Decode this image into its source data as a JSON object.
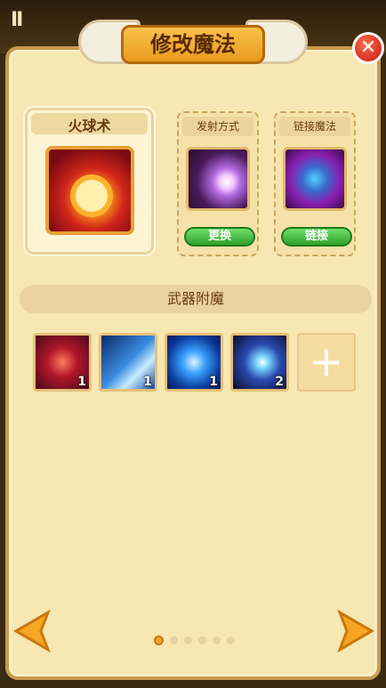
{
  "window": {
    "title": "修改魔法"
  },
  "hud": {
    "pause_icon": "pause-icon"
  },
  "main_spell": {
    "name": "火球术",
    "icon": "fireball-spell-icon"
  },
  "slots": [
    {
      "title": "发射方式",
      "icon": "purple-shot-icon",
      "button": "更换"
    },
    {
      "title": "链接魔法",
      "icon": "chain-link-icon",
      "button": "链接"
    }
  ],
  "enchant": {
    "title": "武器附魔",
    "items": [
      {
        "icon": "red-vortex-icon",
        "count": "1"
      },
      {
        "icon": "ice-slash-icon",
        "count": "1"
      },
      {
        "icon": "blue-disc-icon",
        "count": "1"
      },
      {
        "icon": "lightning-burst-icon",
        "count": "2"
      }
    ],
    "add_label": "+"
  },
  "pager": {
    "pages": 6,
    "active": 0
  },
  "colors": {
    "accent": "#f6a623",
    "close": "#d3261a",
    "button": "#3fb43a"
  }
}
